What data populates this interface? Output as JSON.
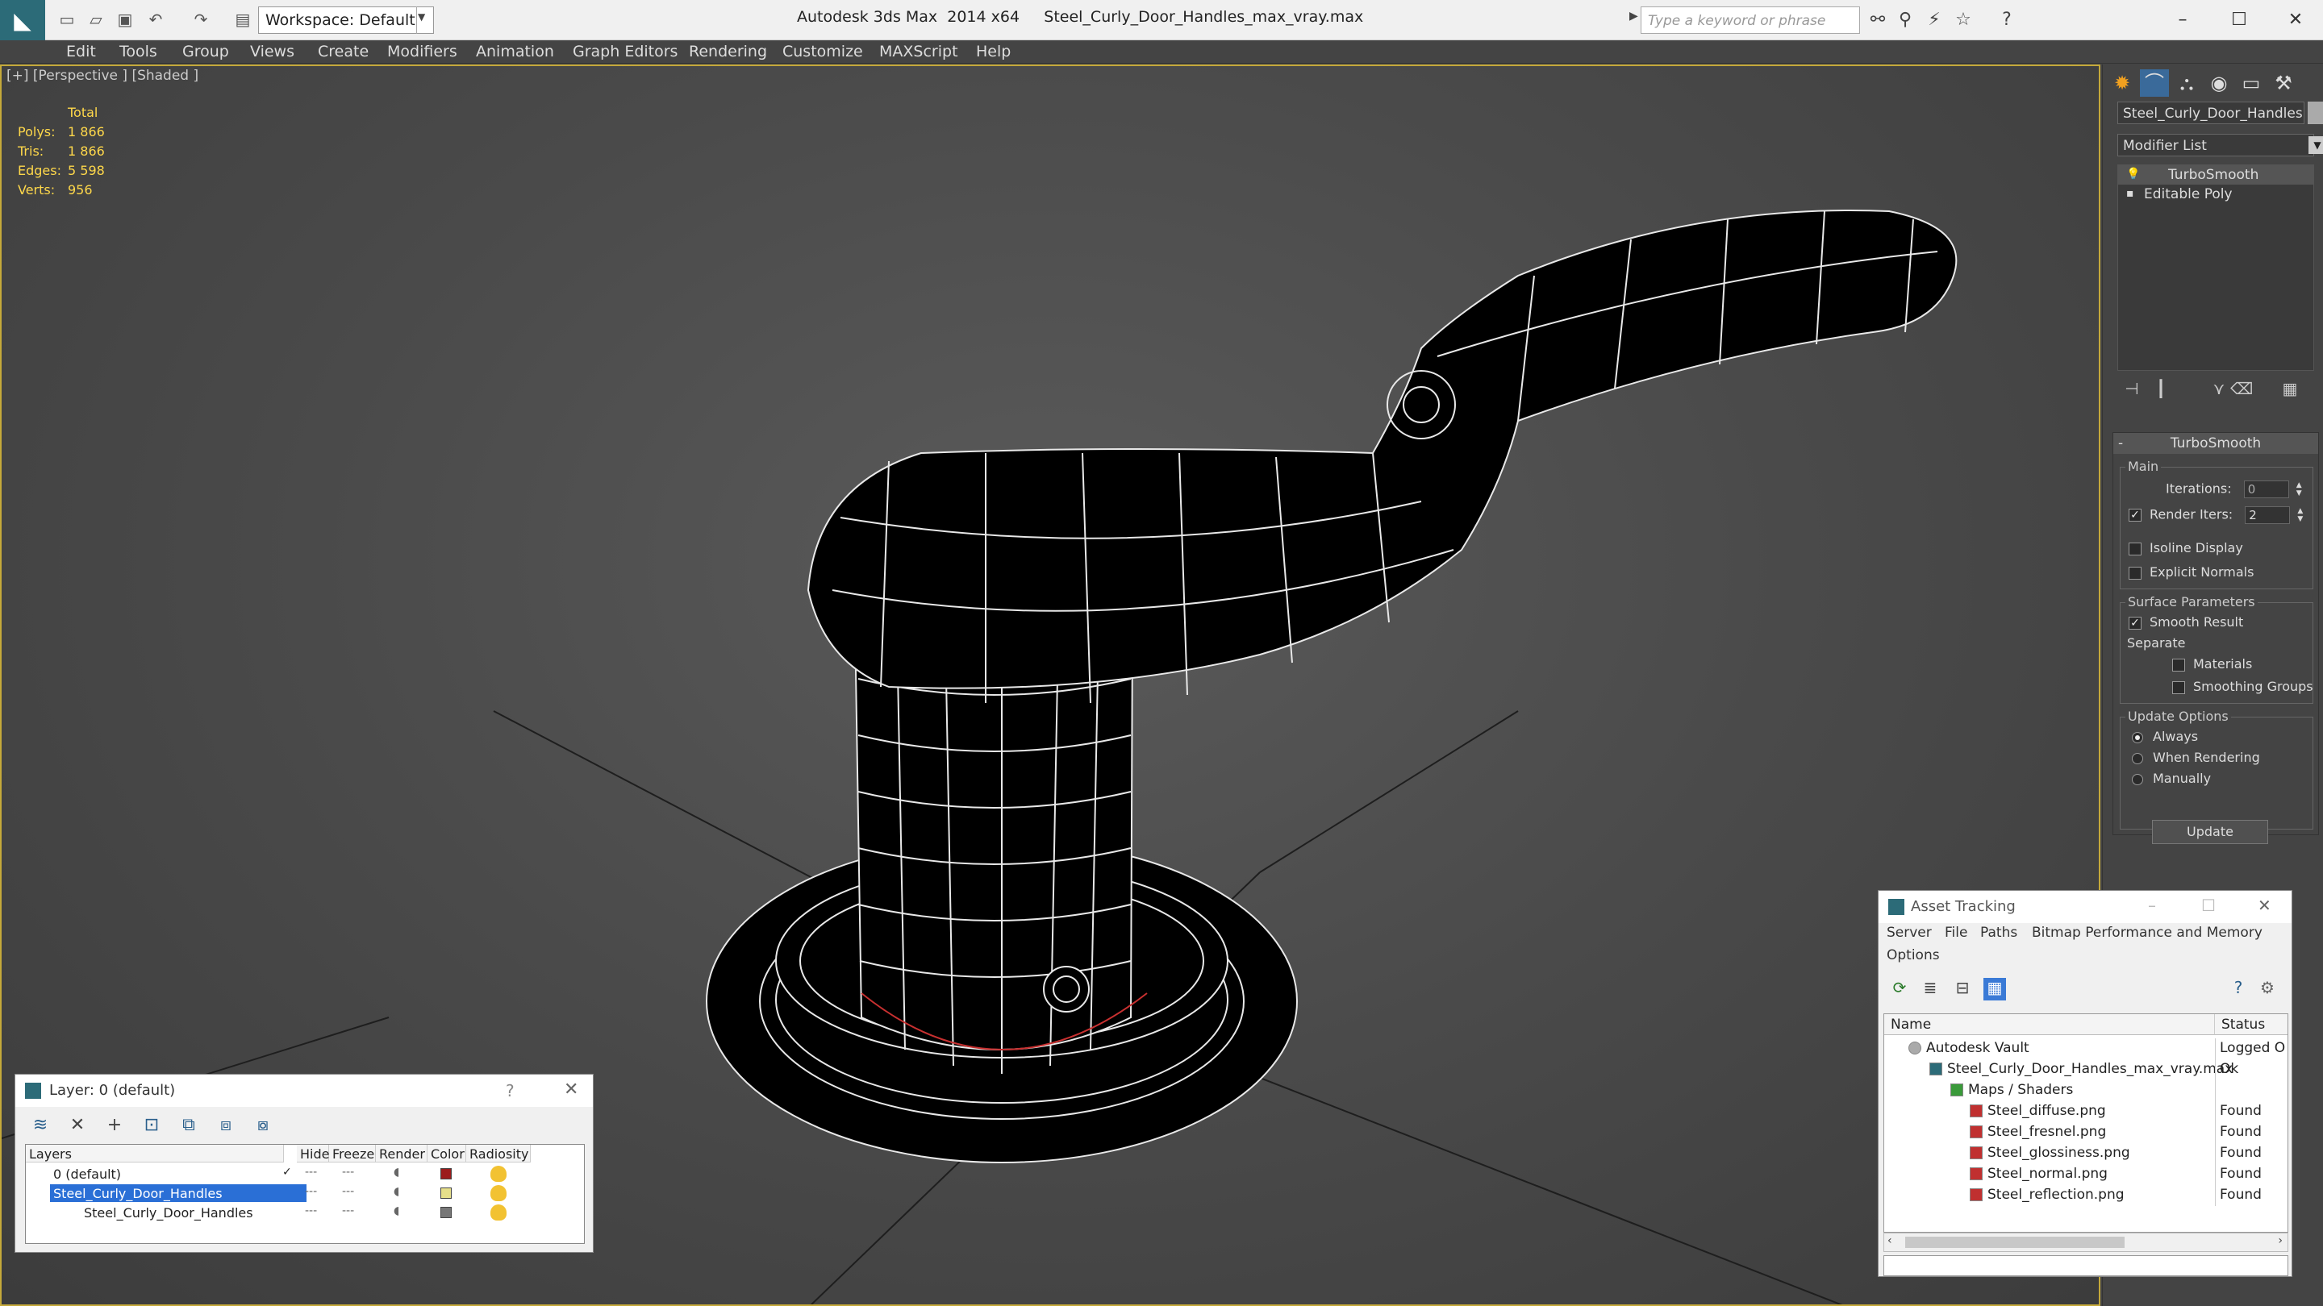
{
  "app": {
    "title": "Autodesk 3ds Max  2014 x64     Steel_Curly_Door_Handles_max_vray.max",
    "logo_icon": "3dsmax-logo-icon",
    "workspace": "Workspace: Default",
    "search_placeholder": "Type a keyword or phrase"
  },
  "menubar": {
    "items": [
      "Edit",
      "Tools",
      "Group",
      "Views",
      "Create",
      "Modifiers",
      "Animation",
      "Graph Editors",
      "Rendering",
      "Customize",
      "MAXScript",
      "Help"
    ]
  },
  "viewport": {
    "label": "[+] [Perspective ] [Shaded ]",
    "stats": {
      "header": "Total",
      "rows": [
        {
          "label": "Polys:",
          "value": "1 866"
        },
        {
          "label": "Tris:",
          "value": "1 866"
        },
        {
          "label": "Edges:",
          "value": "5 598"
        },
        {
          "label": "Verts:",
          "value": "956"
        }
      ]
    }
  },
  "command_panel": {
    "object_name": "Steel_Curly_Door_Handles",
    "modifier_list": "Modifier List",
    "stack": [
      "TurboSmooth",
      "Editable Poly"
    ],
    "rollout": {
      "title": "TurboSmooth",
      "main_label": "Main",
      "iterations_label": "Iterations:",
      "iterations_value": "0",
      "render_iters_label": "Render Iters:",
      "render_iters_value": "2",
      "render_iters_checked": true,
      "isoline_label": "Isoline Display",
      "explicit_normals_label": "Explicit Normals",
      "surface_label": "Surface Parameters",
      "smooth_result_label": "Smooth Result",
      "separate_label": "Separate",
      "materials_label": "Materials",
      "smoothing_groups_label": "Smoothing Groups",
      "update_options_label": "Update Options",
      "always_label": "Always",
      "when_rendering_label": "When Rendering",
      "manually_label": "Manually",
      "update_button": "Update"
    }
  },
  "layer_window": {
    "title": "Layer: 0 (default)",
    "help": "?",
    "columns": [
      "Layers",
      "Hide",
      "Freeze",
      "Render",
      "Color",
      "Radiosity"
    ],
    "rows": [
      {
        "name": "0 (default)",
        "color": "#9c1c1c"
      },
      {
        "name": "Steel_Curly_Door_Handles",
        "color": "#e6df8a"
      },
      {
        "name": "Steel_Curly_Door_Handles",
        "color": "#777777"
      }
    ]
  },
  "asset_window": {
    "title": "Asset Tracking",
    "menu": [
      "Server",
      "File",
      "Paths",
      "Bitmap Performance and Memory",
      "Options"
    ],
    "columns": [
      "Name",
      "Status"
    ],
    "rows": [
      {
        "name": "Autodesk Vault",
        "status": "Logged O"
      },
      {
        "name": "Steel_Curly_Door_Handles_max_vray.max",
        "status": "Ok"
      },
      {
        "name": "Maps / Shaders",
        "status": ""
      },
      {
        "name": "Steel_diffuse.png",
        "status": "Found"
      },
      {
        "name": "Steel_fresnel.png",
        "status": "Found"
      },
      {
        "name": "Steel_glossiness.png",
        "status": "Found"
      },
      {
        "name": "Steel_normal.png",
        "status": "Found"
      },
      {
        "name": "Steel_reflection.png",
        "status": "Found"
      }
    ]
  }
}
